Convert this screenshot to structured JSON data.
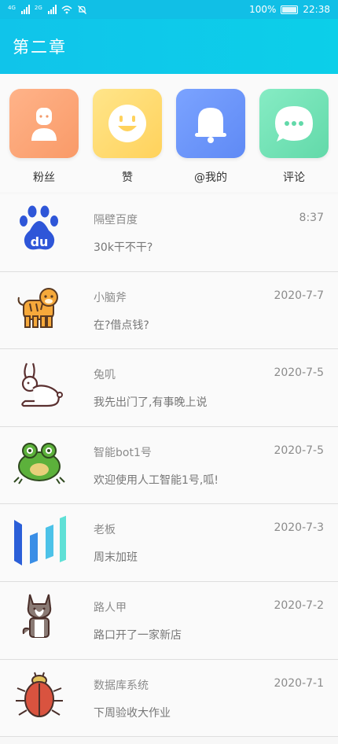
{
  "status": {
    "sim1_tag": "4G",
    "sim2_tag": "2G",
    "battery": "100%",
    "time": "22:38"
  },
  "header": {
    "title": "第二章"
  },
  "quick_actions": [
    {
      "label": "粉丝",
      "icon": "person-icon"
    },
    {
      "label": "赞",
      "icon": "smile-icon"
    },
    {
      "label": "@我的",
      "icon": "bell-icon"
    },
    {
      "label": "评论",
      "icon": "chat-bubble-icon"
    }
  ],
  "messages": [
    {
      "name": "隔壁百度",
      "time": "8:37",
      "text": "30k干不干?",
      "avatar": "baidu-logo-icon"
    },
    {
      "name": "小脑斧",
      "time": "2020-7-7",
      "text": "在?借点钱?",
      "avatar": "tiger-icon"
    },
    {
      "name": "兔叽",
      "time": "2020-7-5",
      "text": "我先出门了,有事晚上说",
      "avatar": "rabbit-icon"
    },
    {
      "name": "智能bot1号",
      "time": "2020-7-5",
      "text": "欢迎使用人工智能1号,呱!",
      "avatar": "frog-icon"
    },
    {
      "name": "老板",
      "time": "2020-7-3",
      "text": "周末加班",
      "avatar": "bars-logo-icon"
    },
    {
      "name": "路人甲",
      "time": "2020-7-2",
      "text": "路口开了一家新店",
      "avatar": "husky-dog-icon"
    },
    {
      "name": "数据库系统",
      "time": "2020-7-1",
      "text": "下周验收大作业",
      "avatar": "beetle-icon"
    }
  ]
}
